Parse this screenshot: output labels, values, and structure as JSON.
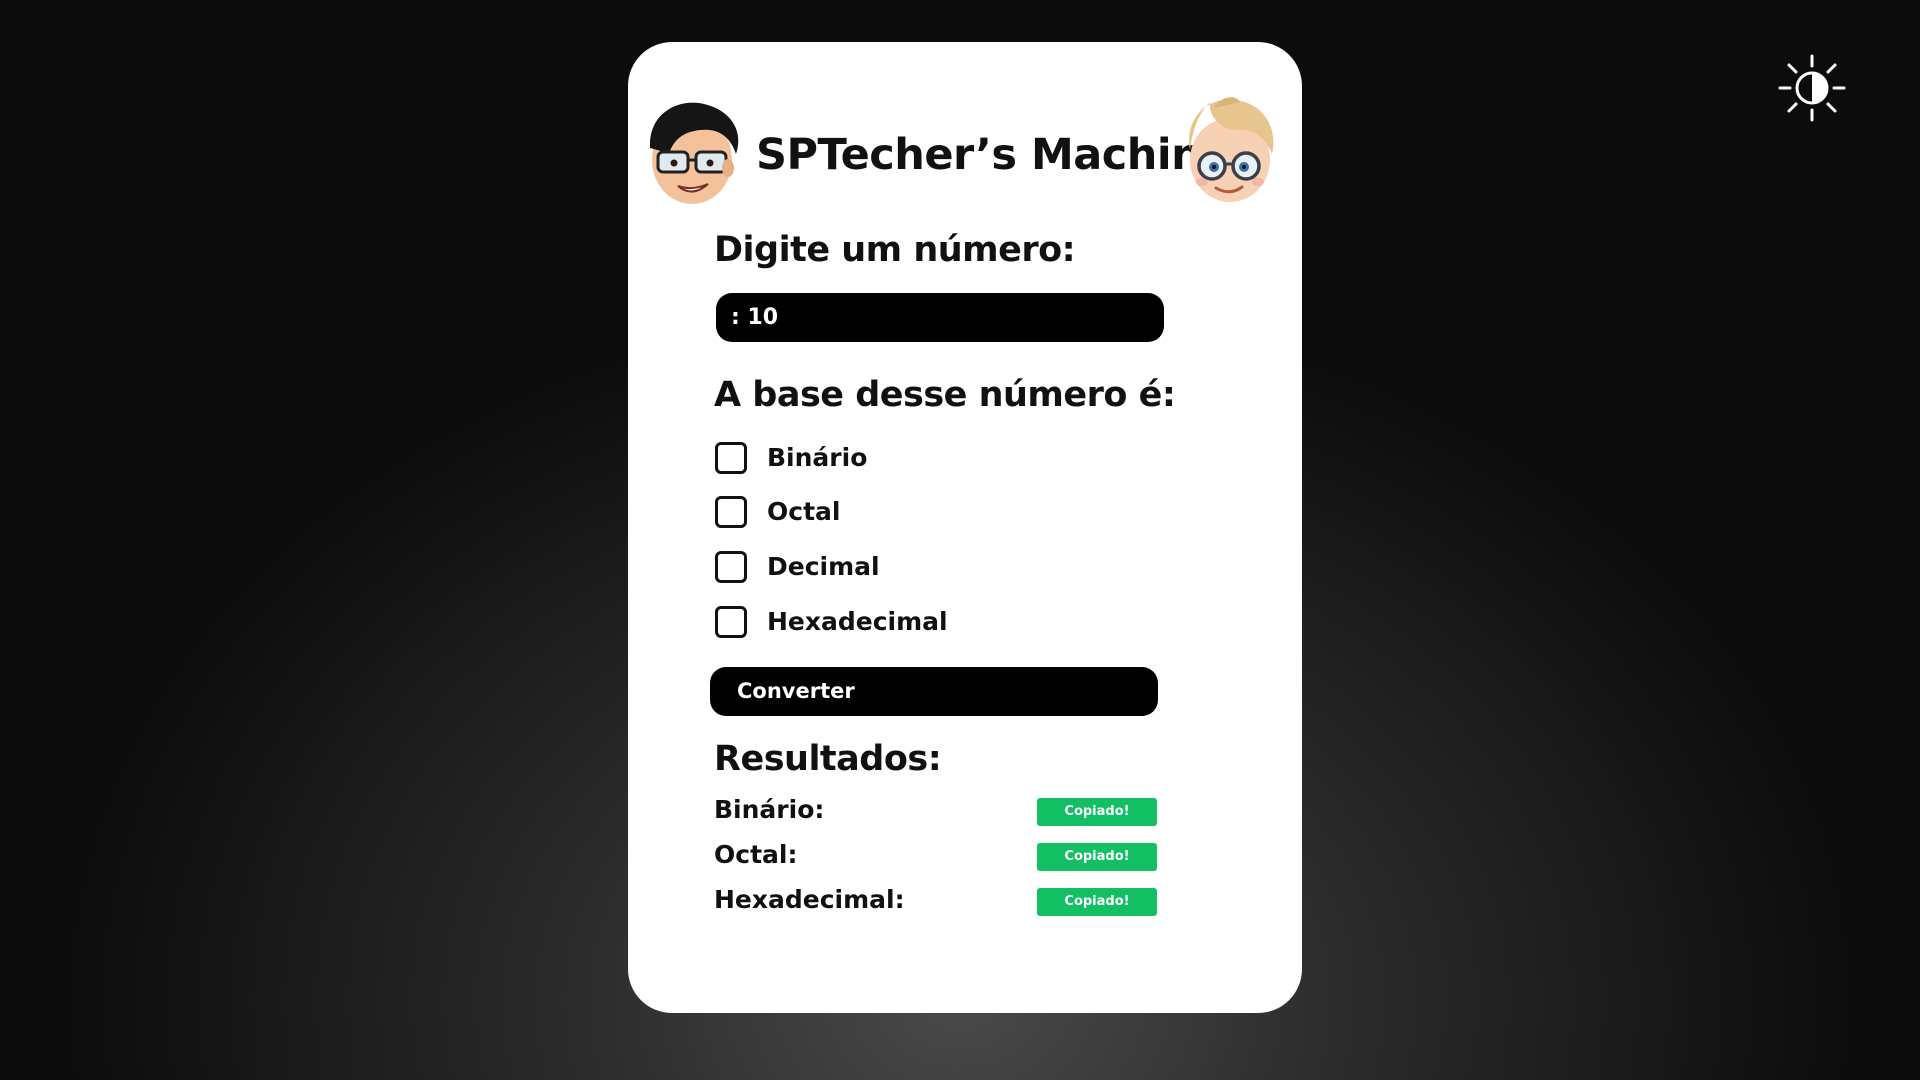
{
  "theme_toggle": {
    "icon": "sun-half-icon"
  },
  "header": {
    "title": "SPTecher’s Machine",
    "avatar_left": "boy-black-hair-glasses",
    "avatar_right": "boy-blonde-hair-glasses"
  },
  "input_section": {
    "label": "Digite um número:",
    "value": ": 10"
  },
  "base_section": {
    "label": "A base desse número é:",
    "options": [
      {
        "label": "Binário",
        "checked": false
      },
      {
        "label": "Octal",
        "checked": false
      },
      {
        "label": "Decimal",
        "checked": false
      },
      {
        "label": "Hexadecimal",
        "checked": false
      }
    ]
  },
  "convert_button": {
    "label": "Converter"
  },
  "results": {
    "title": "Resultados:",
    "rows": [
      {
        "label": "Binário:",
        "copy_label": "Copiado!"
      },
      {
        "label": "Octal:",
        "copy_label": "Copiado!"
      },
      {
        "label": "Hexadecimal:",
        "copy_label": "Copiado!"
      }
    ]
  },
  "colors": {
    "background": "#0c0c0c",
    "card": "#ffffff",
    "accent_copy": "#12bf63",
    "input_bg": "#000000"
  }
}
